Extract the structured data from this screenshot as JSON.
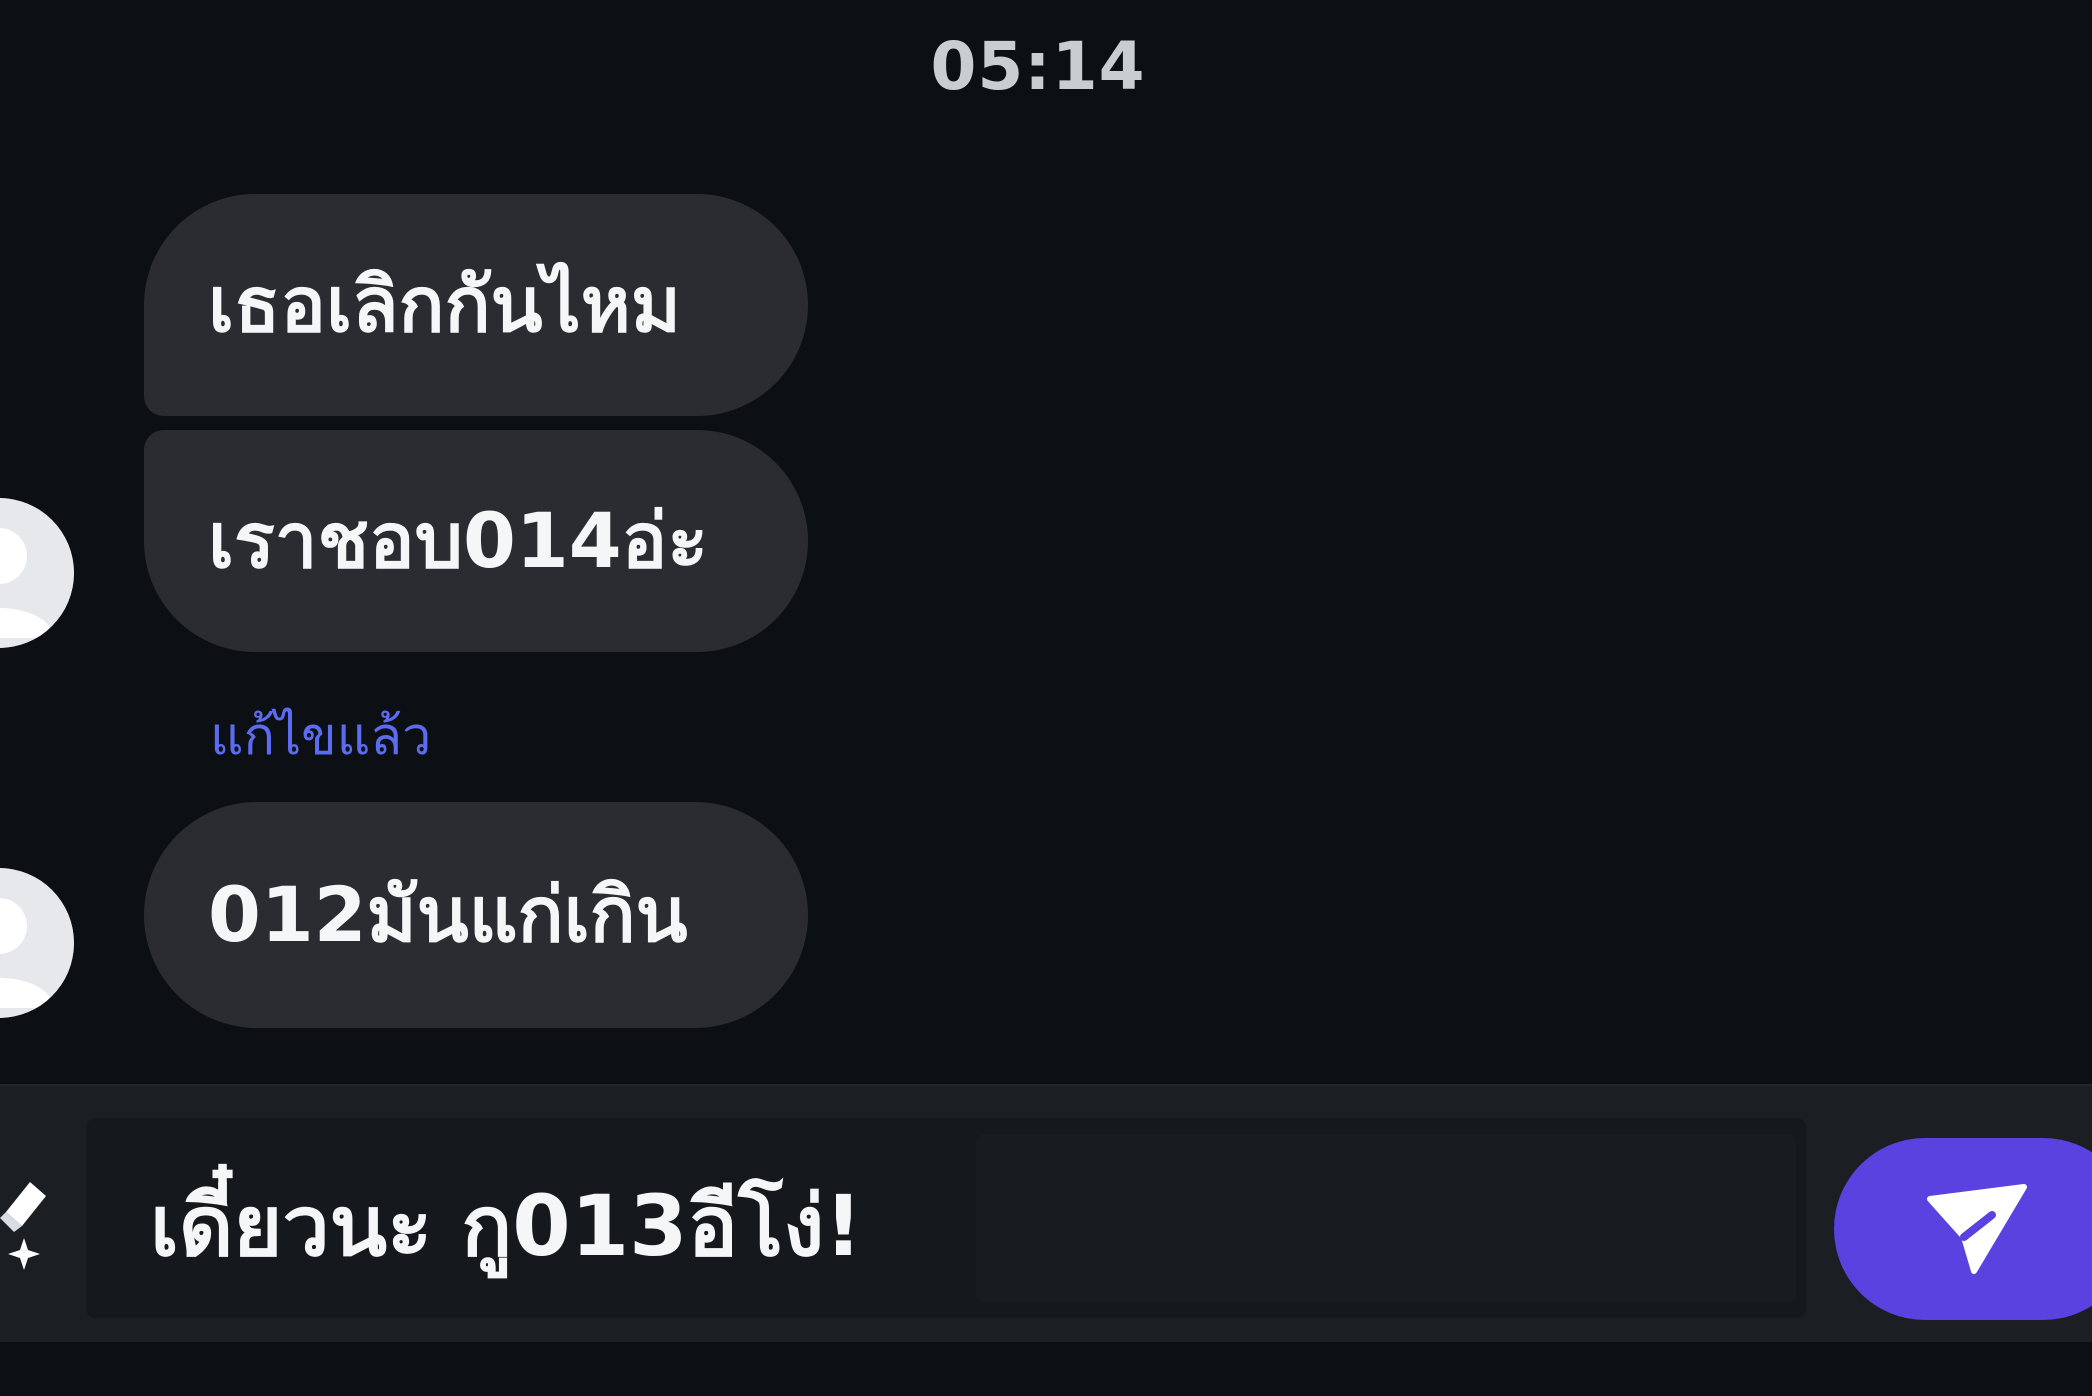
{
  "chat": {
    "timestamp": "05:14",
    "messages": [
      {
        "text": "เธอเลิกกันไหม"
      },
      {
        "text": "เราชอบ014อ่ะ"
      },
      {
        "text": "012มันแก่เกิน"
      }
    ],
    "edited_label": "แก้ไขแล้ว"
  },
  "composer": {
    "draft_text": "เดี๋ยวนะ กู013อีโง่!",
    "send_icon": "send-icon",
    "edit_icon": "ai-edit-icon"
  },
  "colors": {
    "background": "#0c1014",
    "bubble": "#2a2c31",
    "accent": "#5a42e0",
    "edited_label": "#5b6cf0"
  }
}
